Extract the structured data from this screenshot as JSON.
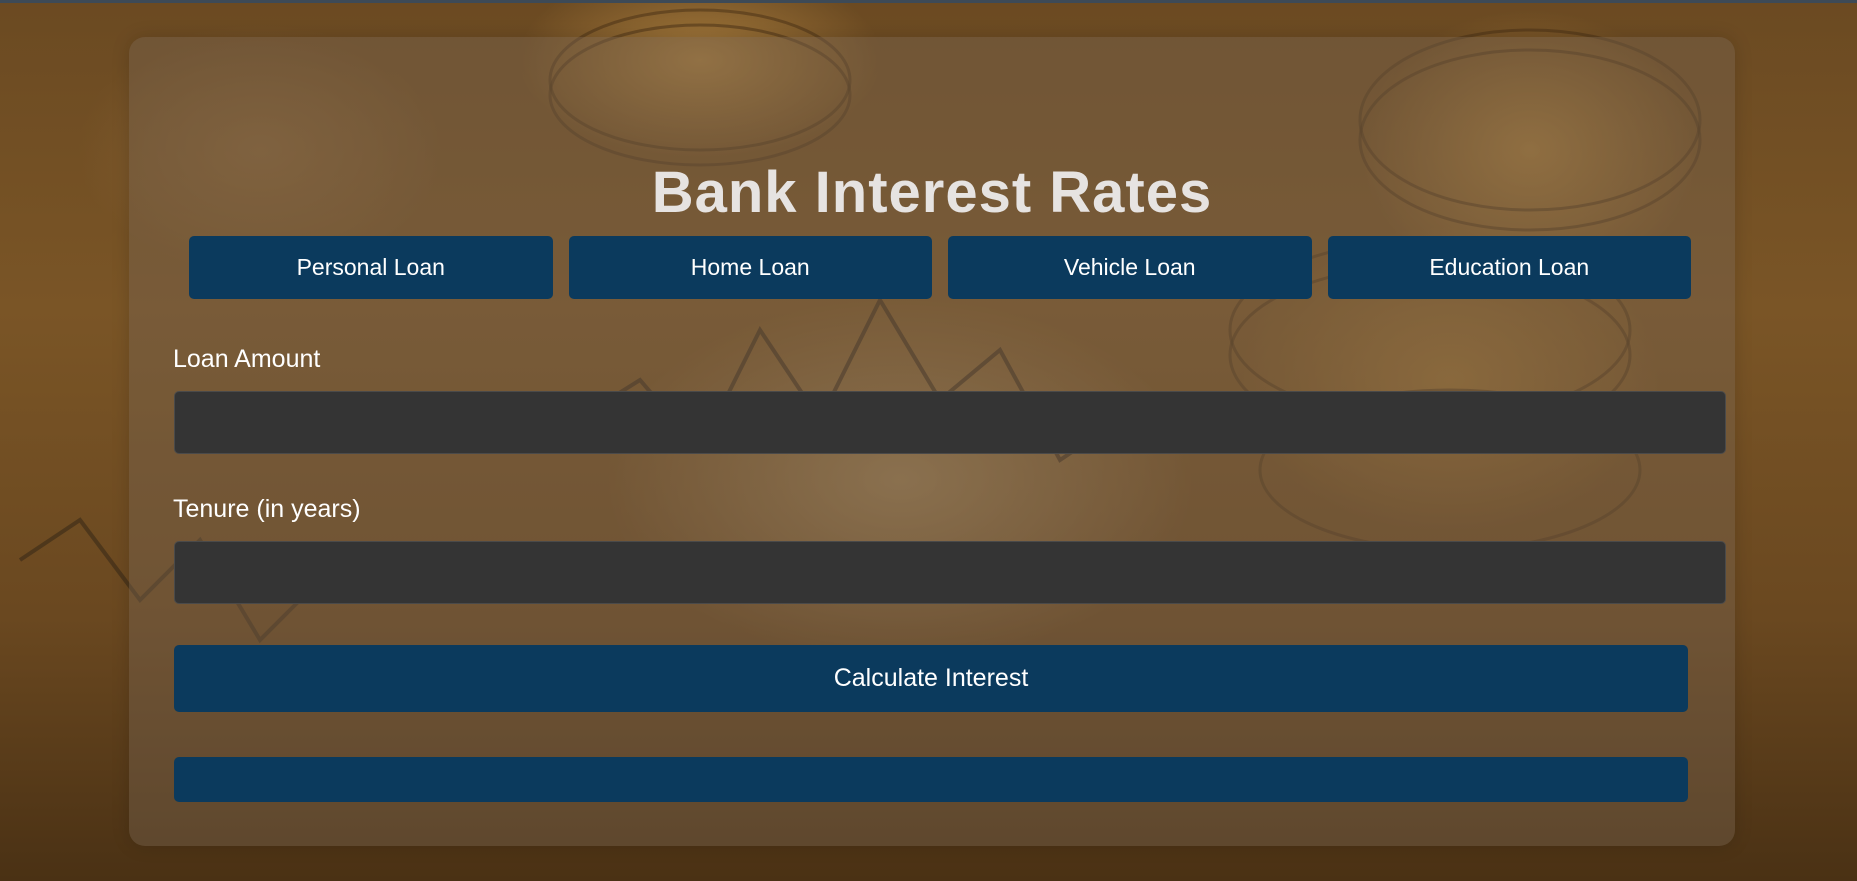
{
  "page": {
    "title": "Bank Interest Rates"
  },
  "loan_types": [
    {
      "label": "Personal Loan"
    },
    {
      "label": "Home Loan"
    },
    {
      "label": "Vehicle Loan"
    },
    {
      "label": "Education Loan"
    }
  ],
  "form": {
    "loan_amount": {
      "label": "Loan Amount",
      "value": "",
      "placeholder": ""
    },
    "tenure": {
      "label": "Tenure (in years)",
      "value": "",
      "placeholder": ""
    },
    "calculate_label": "Calculate Interest",
    "result_text": ""
  },
  "colors": {
    "button_bg": "#0b3a5d",
    "input_bg": "#343434",
    "title_text": "#e6e3e1"
  }
}
